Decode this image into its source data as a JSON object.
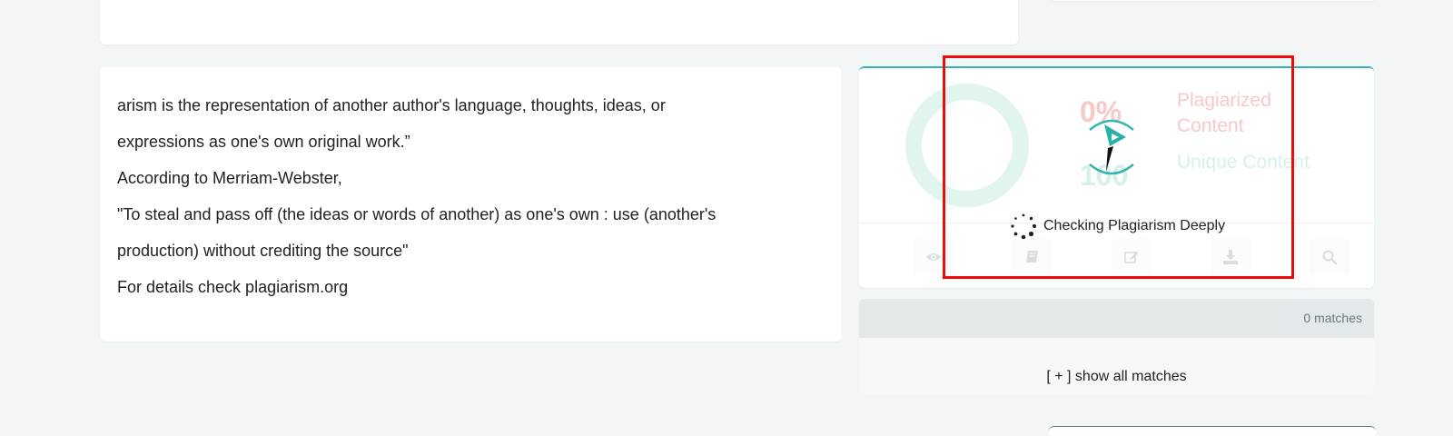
{
  "source_text": {
    "lines": [
      "arism is the representation of another author's language, thoughts, ideas, or",
      "expressions as one's own original work.”",
      "According to Merriam-Webster,",
      "\"To steal and pass off (the ideas or words of another) as one's own : use (another's",
      "production) without crediting the source\"",
      "For details check plagiarism.org"
    ]
  },
  "result": {
    "plagiarized_percent": "0%",
    "unique_percent": "100",
    "plagiarized_label": "Plagiarized Content",
    "unique_label": "Unique Content",
    "status_text": "Checking Plagiarism Deeply",
    "actions": [
      "eye-icon",
      "book-icon",
      "edit-icon",
      "download-icon",
      "search-icon"
    ]
  },
  "matches": {
    "count_text": "0 matches",
    "show_all_label": "[ + ] show all matches"
  },
  "colors": {
    "accent": "#34b5b3",
    "highlight_border": "#ee0b0b",
    "plagiarized": "#f7c9c9",
    "unique": "#d6f1e9"
  }
}
